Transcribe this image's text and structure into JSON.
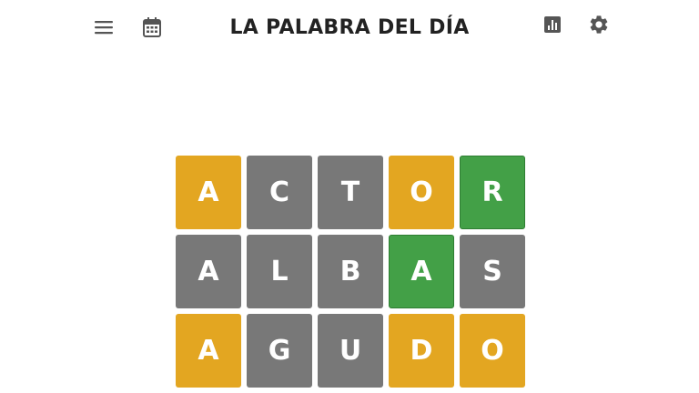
{
  "header": {
    "title": "LA PALABRA DEL DÍA",
    "icons": {
      "menu": "hamburger-menu-icon",
      "calendar": "calendar-icon",
      "stats": "stats-chart-icon",
      "settings": "gear-icon"
    }
  },
  "colors": {
    "present": "#e3a621",
    "absent": "#787878",
    "correct": "#43a047",
    "icon": "#555555",
    "title": "#222222"
  },
  "board": {
    "rows": [
      [
        {
          "letter": "A",
          "state": "present"
        },
        {
          "letter": "C",
          "state": "absent"
        },
        {
          "letter": "T",
          "state": "absent"
        },
        {
          "letter": "O",
          "state": "present"
        },
        {
          "letter": "R",
          "state": "correct"
        }
      ],
      [
        {
          "letter": "A",
          "state": "absent"
        },
        {
          "letter": "L",
          "state": "absent"
        },
        {
          "letter": "B",
          "state": "absent"
        },
        {
          "letter": "A",
          "state": "correct"
        },
        {
          "letter": "S",
          "state": "absent"
        }
      ],
      [
        {
          "letter": "A",
          "state": "present"
        },
        {
          "letter": "G",
          "state": "absent"
        },
        {
          "letter": "U",
          "state": "absent"
        },
        {
          "letter": "D",
          "state": "present"
        },
        {
          "letter": "O",
          "state": "present"
        }
      ]
    ]
  }
}
